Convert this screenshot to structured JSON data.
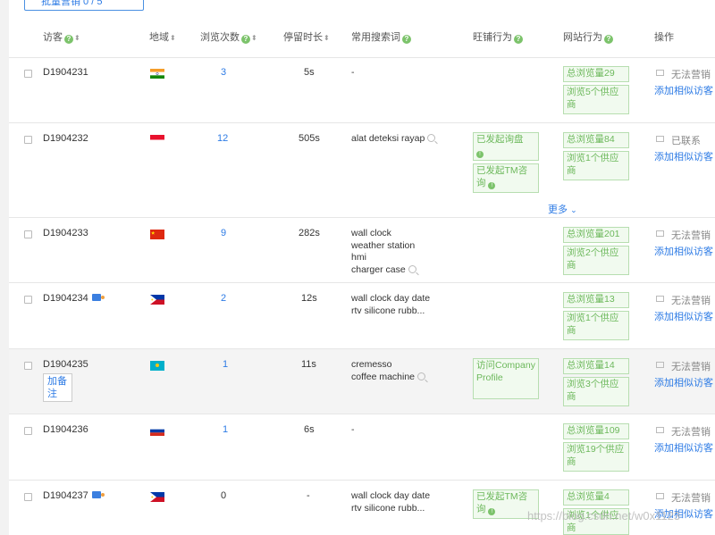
{
  "toolbar": {
    "batch_label": "批量营销  0 / 5"
  },
  "columns": {
    "visitor": "访客",
    "region": "地域",
    "views": "浏览次数",
    "duration": "停留时长",
    "keywords": "常用搜索词",
    "wangpu": "旺铺行为",
    "website": "网站行为",
    "actions": "操作"
  },
  "more_label": "更多",
  "note_label": "加备注",
  "add_similar_label": "添加相似访客",
  "rows": [
    {
      "id": "D1904231",
      "views": "3",
      "duration": "5s",
      "kw1": "-",
      "kw2": "",
      "kw3": "",
      "kw4": "",
      "wp1": "",
      "wp2": "",
      "pv": "总浏览量29",
      "sup": "浏览5个供应商",
      "status": "无法营销"
    },
    {
      "id": "D1904232",
      "views": "12",
      "duration": "505s",
      "kw1": "alat deteksi rayap",
      "kw2": "",
      "kw3": "",
      "kw4": "",
      "wp1": "已发起询盘",
      "wp2": "已发起TM咨询",
      "pv": "总浏览量84",
      "sup": "浏览1个供应商",
      "status": "已联系"
    },
    {
      "id": "D1904233",
      "views": "9",
      "duration": "282s",
      "kw1": "wall clock",
      "kw2": "weather station",
      "kw3": "hmi",
      "kw4": "charger case",
      "wp1": "",
      "wp2": "",
      "pv": "总浏览量201",
      "sup": "浏览2个供应商",
      "status": "无法营销"
    },
    {
      "id": "D1904234",
      "views": "2",
      "duration": "12s",
      "kw1": "wall clock day date",
      "kw2": "rtv silicone rubb...",
      "kw3": "",
      "kw4": "",
      "wp1": "",
      "wp2": "",
      "pv": "总浏览量13",
      "sup": "浏览1个供应商",
      "status": "无法营销"
    },
    {
      "id": "D1904235",
      "views": "1",
      "duration": "11s",
      "kw1": "cremesso",
      "kw2": "coffee machine",
      "kw3": "",
      "kw4": "",
      "wp1": "访问Company Profile",
      "wp2": "",
      "pv": "总浏览量14",
      "sup": "浏览3个供应商",
      "status": "无法营销"
    },
    {
      "id": "D1904236",
      "views": "1",
      "duration": "6s",
      "kw1": "-",
      "kw2": "",
      "kw3": "",
      "kw4": "",
      "wp1": "",
      "wp2": "",
      "pv": "总浏览量109",
      "sup": "浏览19个供应商",
      "status": "无法营销"
    },
    {
      "id": "D1904237",
      "views": "0",
      "duration": "-",
      "kw1": "wall clock day date",
      "kw2": "rtv silicone rubb...",
      "kw3": "",
      "kw4": "",
      "wp1": "已发起TM咨询",
      "wp2": "",
      "pv": "总浏览量4",
      "sup": "浏览1个供应商",
      "status": "无法营销"
    }
  ],
  "flags": {
    "india": {
      "top": "#f59d2a",
      "mid": "#ffffff",
      "bot": "#138808",
      "wheel": "#1a237e"
    },
    "indonesia": {
      "top": "#e8112d",
      "bot": "#ffffff"
    },
    "china": {
      "field": "#de2910",
      "star": "#ffde00"
    },
    "philippines": {
      "top": "#0038a8",
      "bot": "#ce1126",
      "tri": "#ffffff"
    },
    "kazakhstan": {
      "field": "#00afca",
      "sun": "#fec50c"
    },
    "russia": {
      "top": "#ffffff",
      "mid": "#0039a6",
      "bot": "#d52b1e"
    }
  },
  "watermark": "https://blog.csdn.net/w0x1123"
}
